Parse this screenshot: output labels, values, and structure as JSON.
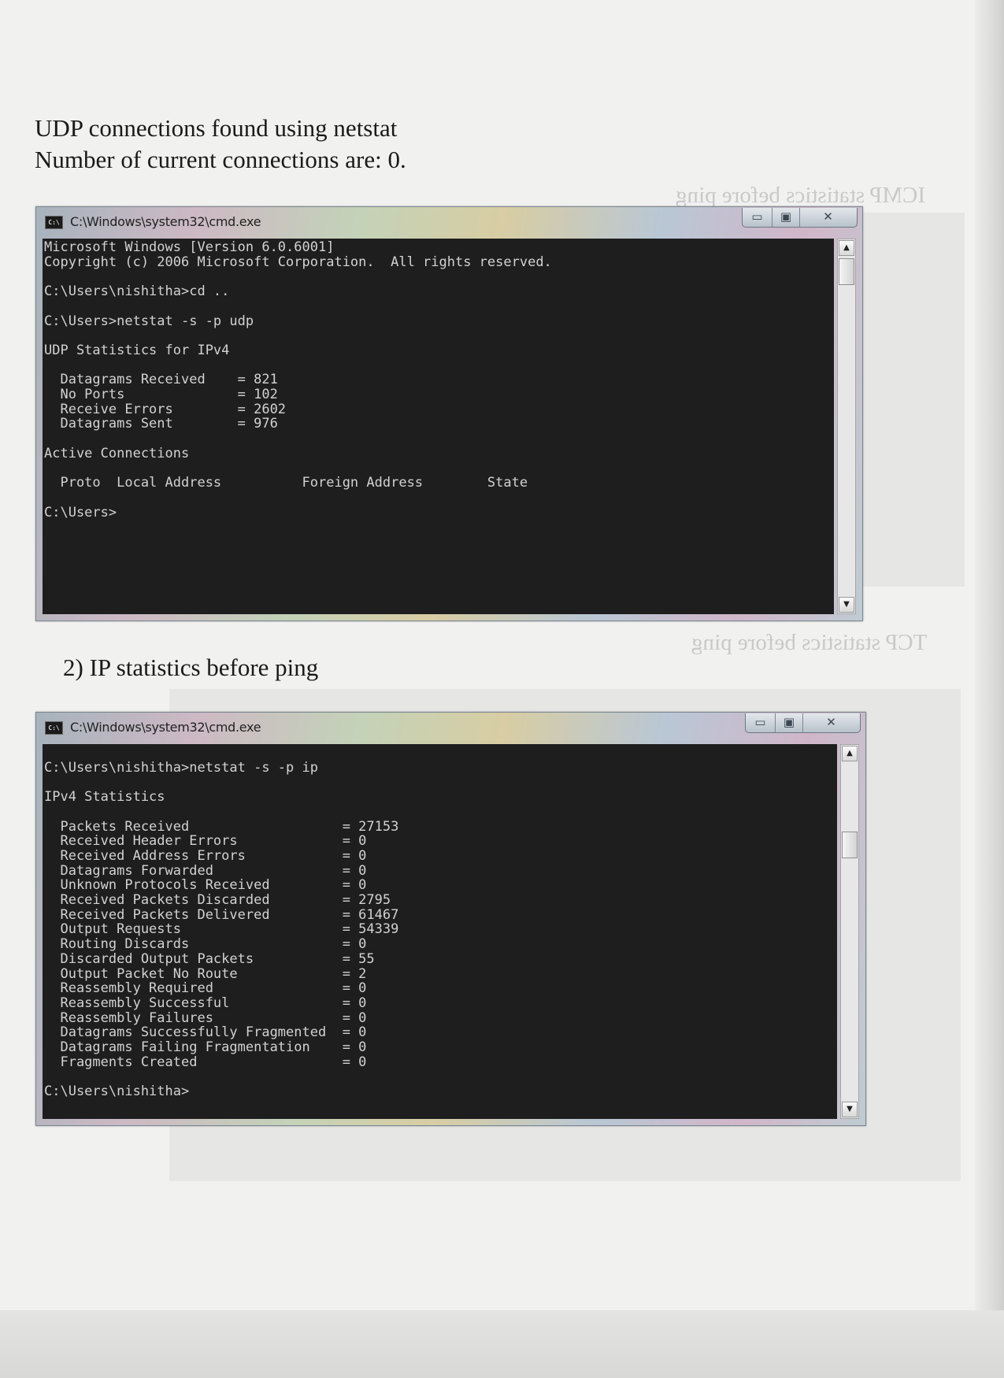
{
  "document": {
    "line_1": "UDP connections found using netstat",
    "line_2": "Number of current connections are: 0.",
    "section_2_heading": "2) IP statistics before ping"
  },
  "show_through": {
    "text_1": "ICMP statistics before ping",
    "text_2": "TCP statistics before ping"
  },
  "window_1": {
    "title": "C:\\Windows\\system32\\cmd.exe",
    "icon": "cmd-icon",
    "output": "Microsoft Windows [Version 6.0.6001]\nCopyright (c) 2006 Microsoft Corporation.  All rights reserved.\n\nC:\\Users\\nishitha>cd ..\n\nC:\\Users>netstat -s -p udp\n\nUDP Statistics for IPv4\n\n  Datagrams Received    = 821\n  No Ports              = 102\n  Receive Errors        = 2602\n  Datagrams Sent        = 976\n\nActive Connections\n\n  Proto  Local Address          Foreign Address        State\n\nC:\\Users>"
  },
  "window_2": {
    "title": "C:\\Windows\\system32\\cmd.exe",
    "icon": "cmd-icon",
    "output": "\nC:\\Users\\nishitha>netstat -s -p ip\n\nIPv4 Statistics\n\n  Packets Received                   = 27153\n  Received Header Errors             = 0\n  Received Address Errors            = 0\n  Datagrams Forwarded                = 0\n  Unknown Protocols Received         = 0\n  Received Packets Discarded         = 2795\n  Received Packets Delivered         = 61467\n  Output Requests                    = 54339\n  Routing Discards                   = 0\n  Discarded Output Packets           = 55\n  Output Packet No Route             = 2\n  Reassembly Required                = 0\n  Reassembly Successful              = 0\n  Reassembly Failures                = 0\n  Datagrams Successfully Fragmented  = 0\n  Datagrams Failing Fragmentation    = 0\n  Fragments Created                  = 0\n\nC:\\Users\\nishitha>"
  },
  "window_controls": {
    "minimize_glyph": "▭",
    "maximize_glyph": "▣",
    "close_glyph": "✕",
    "scroll_up_glyph": "▲",
    "scroll_down_glyph": "▼"
  },
  "colors": {
    "console_background": "#1e1e1f",
    "console_text": "#d2d2d2",
    "paper": "#f1f1f0"
  }
}
